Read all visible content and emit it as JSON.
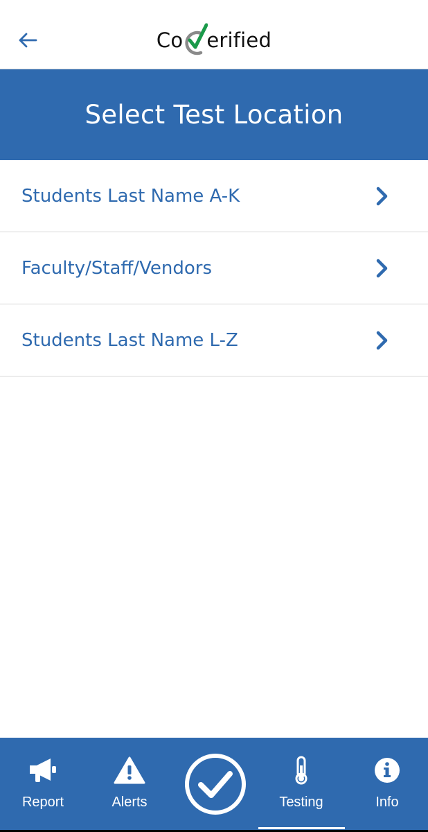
{
  "header": {
    "back_icon": "arrow-left-icon",
    "logo": {
      "prefix": "Co",
      "suffix": "erified",
      "mark_icon": "check-circle-logo-icon"
    }
  },
  "page": {
    "title": "Select Test Location"
  },
  "locations": [
    {
      "label": "Students Last Name A-K",
      "icon": "chevron-right-icon"
    },
    {
      "label": "Faculty/Staff/Vendors",
      "icon": "chevron-right-icon"
    },
    {
      "label": "Students Last Name L-Z",
      "icon": "chevron-right-icon"
    }
  ],
  "bottom_nav": {
    "items": [
      {
        "label": "Report",
        "icon": "megaphone-icon"
      },
      {
        "label": "Alerts",
        "icon": "warning-icon"
      },
      {
        "label": "",
        "icon": "check-circle-icon"
      },
      {
        "label": "Testing",
        "icon": "thermometer-icon",
        "active": true
      },
      {
        "label": "Info",
        "icon": "info-icon"
      }
    ]
  },
  "colors": {
    "primary": "#2f6aaf",
    "logo_check": "#1a9a4a",
    "logo_ring": "#8a8a8a",
    "divider": "#d6d6d6"
  }
}
